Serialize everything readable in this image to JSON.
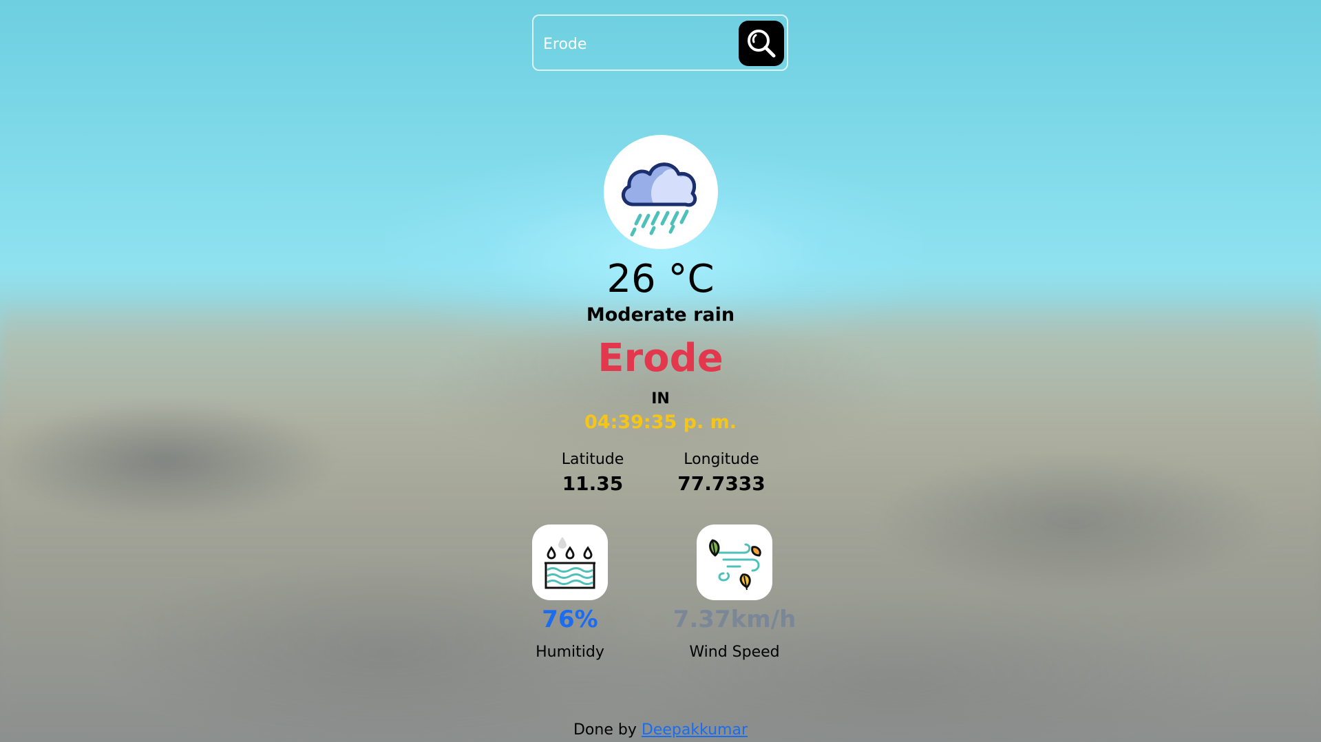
{
  "search": {
    "value": "Erode",
    "button_icon": "search-icon"
  },
  "weather": {
    "icon": "rain-cloud-icon",
    "temperature": "26 °C",
    "condition": "Moderate rain",
    "city": "Erode",
    "country": "IN",
    "local_time": "04:39:35 p. m."
  },
  "coordinates": {
    "latitude_label": "Latitude",
    "latitude_value": "11.35",
    "longitude_label": "Longitude",
    "longitude_value": "77.7333"
  },
  "stats": {
    "humidity": {
      "icon": "humidity-icon",
      "value": "76%",
      "label": "Humitidy"
    },
    "wind": {
      "icon": "wind-icon",
      "value": "7.37km/h",
      "label": "Wind Speed"
    }
  },
  "footer": {
    "prefix": "Done by",
    "author_link": "Deepakkumar"
  },
  "colors": {
    "city": "#e3374e",
    "time": "#f5c518",
    "humidity_value": "#1a6cf0",
    "wind_value": "#7a8796",
    "link": "#1a6cf0"
  }
}
